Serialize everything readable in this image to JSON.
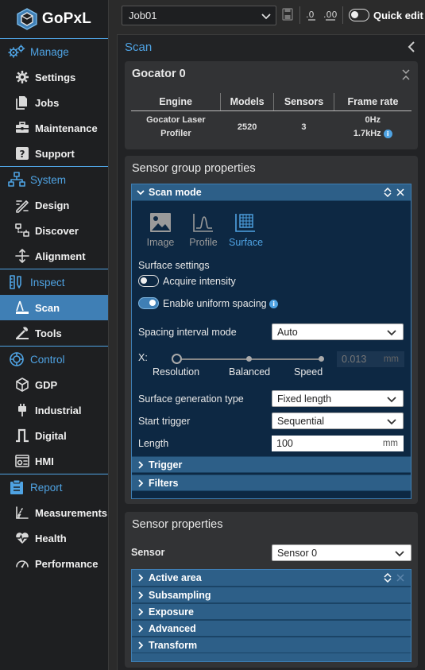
{
  "app": {
    "name": "GoPxL"
  },
  "sidebar": {
    "sections": [
      {
        "label": "Manage",
        "items": [
          {
            "label": "Settings"
          },
          {
            "label": "Jobs"
          },
          {
            "label": "Maintenance"
          },
          {
            "label": "Support"
          }
        ]
      },
      {
        "label": "System",
        "items": [
          {
            "label": "Design"
          },
          {
            "label": "Discover"
          },
          {
            "label": "Alignment"
          }
        ]
      },
      {
        "label": "Inspect",
        "items": [
          {
            "label": "Scan"
          },
          {
            "label": "Tools"
          }
        ]
      },
      {
        "label": "Control",
        "items": [
          {
            "label": "GDP"
          },
          {
            "label": "Industrial"
          },
          {
            "label": "Digital"
          },
          {
            "label": "HMI"
          }
        ]
      },
      {
        "label": "Report",
        "items": [
          {
            "label": "Measurements"
          },
          {
            "label": "Health"
          },
          {
            "label": "Performance"
          }
        ]
      }
    ],
    "active_item": "Scan"
  },
  "topbar": {
    "job": "Job01",
    "quick_edit_label": "Quick edit",
    "quick_edit_on": false
  },
  "main": {
    "title": "Scan",
    "sensor_card": {
      "title": "Gocator 0",
      "headers": [
        "Engine",
        "Models",
        "Sensors",
        "Frame rate"
      ],
      "row": {
        "engine_line1": "Gocator Laser",
        "engine_line2": "Profiler",
        "models": "2520",
        "sensors": "3",
        "frame_line1": "0Hz",
        "frame_line2": "1.7kHz"
      }
    },
    "group_props": {
      "title": "Sensor group properties",
      "scan_mode": {
        "label": "Scan mode",
        "modes": [
          {
            "label": "Image",
            "icon": "image-icon"
          },
          {
            "label": "Profile",
            "icon": "profile-icon"
          },
          {
            "label": "Surface",
            "icon": "surface-icon"
          }
        ],
        "selected": "Surface",
        "surface_settings_label": "Surface settings",
        "acquire_intensity_label": "Acquire intensity",
        "acquire_intensity_on": false,
        "uniform_spacing_label": "Enable uniform spacing",
        "uniform_spacing_on": true,
        "spacing_mode_label": "Spacing interval mode",
        "spacing_mode_value": "Auto",
        "x_label": "X:",
        "slider_labels": [
          "Resolution",
          "Balanced",
          "Speed"
        ],
        "slider_value": "Resolution",
        "x_value": "0.013",
        "x_unit": "mm",
        "gen_type_label": "Surface generation type",
        "gen_type_value": "Fixed length",
        "start_trigger_label": "Start trigger",
        "start_trigger_value": "Sequential",
        "length_label": "Length",
        "length_value": "100",
        "length_unit": "mm"
      },
      "collapsed": [
        "Trigger",
        "Filters"
      ]
    },
    "sensor_props": {
      "title": "Sensor properties",
      "sensor_label": "Sensor",
      "sensor_value": "Sensor 0",
      "sections": [
        "Active area",
        "Subsampling",
        "Exposure",
        "Advanced",
        "Transform"
      ]
    }
  },
  "colors": {
    "accent": "#4fa3e3",
    "active_bg": "#3f7fb5",
    "panel_bg": "#0d2843"
  }
}
